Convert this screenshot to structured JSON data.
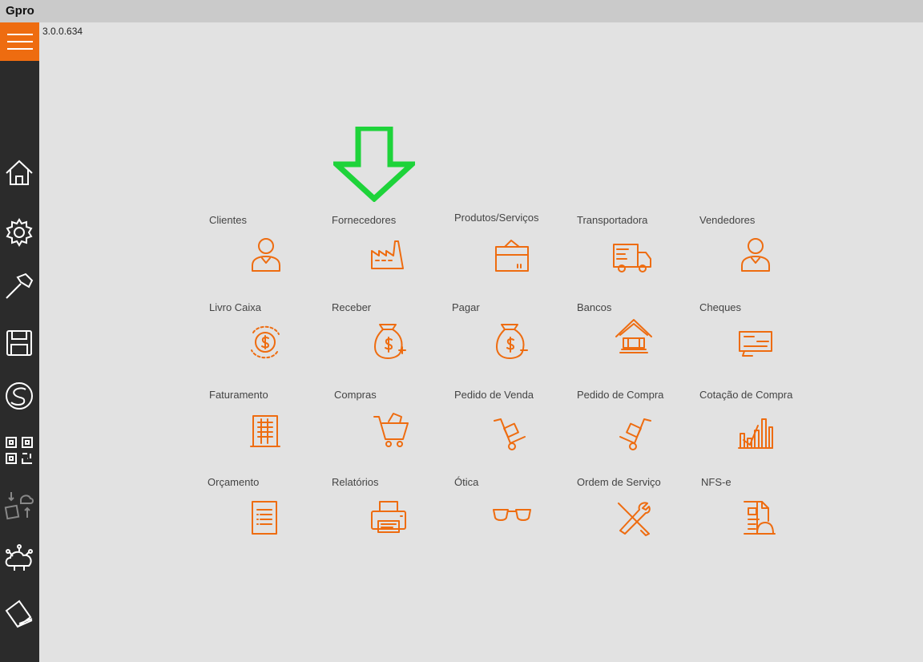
{
  "window": {
    "title": "Gpro"
  },
  "version": "3.0.0.634",
  "sidebar": {
    "items": [
      {
        "icon": "home-icon"
      },
      {
        "icon": "gear-icon"
      },
      {
        "icon": "hammer-icon"
      },
      {
        "icon": "floppy-disk-icon"
      },
      {
        "icon": "logo-s-icon"
      },
      {
        "icon": "qr-code-icon"
      },
      {
        "icon": "cloud-sync-icon"
      },
      {
        "icon": "cloud-network-icon"
      },
      {
        "icon": "book-icon"
      }
    ]
  },
  "highlight_arrow_color": "#1ed33a",
  "accent_color": "#ee6c10",
  "tiles": [
    {
      "label": "Clientes",
      "icon": "person-icon"
    },
    {
      "label": "Fornecedores",
      "icon": "factory-icon"
    },
    {
      "label": "Produtos/Serviços",
      "icon": "box-icon"
    },
    {
      "label": "Transportadora",
      "icon": "truck-icon"
    },
    {
      "label": "Vendedores",
      "icon": "person-icon"
    },
    {
      "label": "Livro Caixa",
      "icon": "money-cycle-icon"
    },
    {
      "label": "Receber",
      "icon": "money-bag-plus-icon"
    },
    {
      "label": "Pagar",
      "icon": "money-bag-minus-icon"
    },
    {
      "label": "Bancos",
      "icon": "bank-icon"
    },
    {
      "label": "Cheques",
      "icon": "cheque-icon"
    },
    {
      "label": "Faturamento",
      "icon": "invoice-icon"
    },
    {
      "label": "Compras",
      "icon": "shopping-cart-icon"
    },
    {
      "label": "Pedido de Venda",
      "icon": "hand-truck-icon"
    },
    {
      "label": "Pedido de Compra",
      "icon": "hand-truck-icon"
    },
    {
      "label": "Cotação de Compra",
      "icon": "bar-chart-icon"
    },
    {
      "label": "Orçamento",
      "icon": "document-list-icon"
    },
    {
      "label": "Relatórios",
      "icon": "printer-icon"
    },
    {
      "label": "Ótica",
      "icon": "glasses-icon"
    },
    {
      "label": "Ordem de Serviço",
      "icon": "tools-icon"
    },
    {
      "label": "NFS-e",
      "icon": "document-helmet-icon"
    }
  ]
}
